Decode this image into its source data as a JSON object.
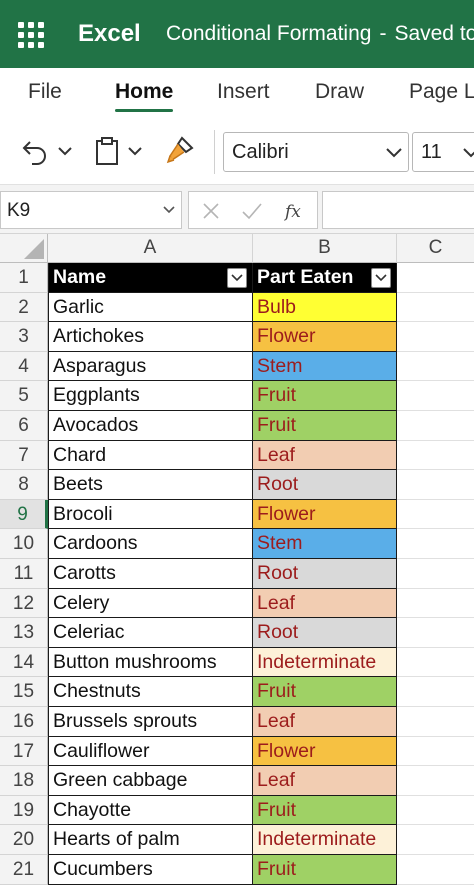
{
  "titlebar": {
    "app_name": "Excel",
    "doc_title": "Conditional Formating",
    "separator": "-",
    "save_status": "Saved to",
    "accent_color": "#217346"
  },
  "ribbon_tabs": [
    "File",
    "Home",
    "Insert",
    "Draw",
    "Page La"
  ],
  "toolbar": {
    "icons": [
      "undo-icon",
      "chevron-down-icon",
      "paste-icon",
      "chevron-down-icon",
      "format-painter-icon"
    ],
    "font_name": "Calibri",
    "font_size": "11"
  },
  "formula_bar": {
    "name_box": "K9",
    "cancel_icon": "close-icon",
    "enter_icon": "check-icon",
    "function_icon": "fx-icon",
    "formula_value": ""
  },
  "sheet": {
    "columns": [
      "A",
      "B",
      "C"
    ],
    "selected_row": "9",
    "header": {
      "row": "1",
      "name": "Name",
      "part": "Part Eaten"
    },
    "part_colors": {
      "Bulb": "#ffff33",
      "Flower": "#f6c142",
      "Stem": "#5aaee8",
      "Fruit": "#9fd165",
      "Leaf": "#f2cdb2",
      "Root": "#d9d9d9",
      "Indeterminate": "#fdf1d8"
    },
    "rows": [
      {
        "num": "2",
        "name": "Garlic",
        "part": "Bulb"
      },
      {
        "num": "3",
        "name": "Artichokes",
        "part": "Flower"
      },
      {
        "num": "4",
        "name": "Asparagus",
        "part": "Stem"
      },
      {
        "num": "5",
        "name": "Eggplants",
        "part": "Fruit"
      },
      {
        "num": "6",
        "name": "Avocados",
        "part": "Fruit"
      },
      {
        "num": "7",
        "name": "Chard",
        "part": "Leaf"
      },
      {
        "num": "8",
        "name": "Beets",
        "part": "Root"
      },
      {
        "num": "9",
        "name": "Brocoli",
        "part": "Flower"
      },
      {
        "num": "10",
        "name": "Cardoons",
        "part": "Stem"
      },
      {
        "num": "11",
        "name": "Carotts",
        "part": "Root"
      },
      {
        "num": "12",
        "name": "Celery",
        "part": "Leaf"
      },
      {
        "num": "13",
        "name": "Celeriac",
        "part": "Root"
      },
      {
        "num": "14",
        "name": "Button mushrooms",
        "part": "Indeterminate"
      },
      {
        "num": "15",
        "name": "Chestnuts",
        "part": "Fruit"
      },
      {
        "num": "16",
        "name": "Brussels sprouts",
        "part": "Leaf"
      },
      {
        "num": "17",
        "name": "Cauliflower",
        "part": "Flower"
      },
      {
        "num": "18",
        "name": "Green cabbage",
        "part": "Leaf"
      },
      {
        "num": "19",
        "name": "Chayotte",
        "part": "Fruit"
      },
      {
        "num": "20",
        "name": "Hearts of palm",
        "part": "Indeterminate"
      },
      {
        "num": "21",
        "name": "Cucumbers",
        "part": "Fruit"
      }
    ]
  }
}
